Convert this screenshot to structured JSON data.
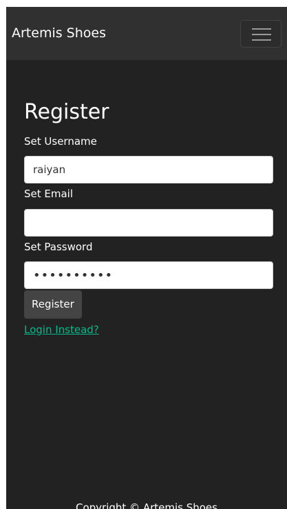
{
  "navbar": {
    "brand": "Artemis Shoes",
    "toggle_icon": "hamburger-menu-icon"
  },
  "form": {
    "title": "Register",
    "username": {
      "label": "Set Username",
      "value": "raiyan"
    },
    "email": {
      "label": "Set Email",
      "value": ""
    },
    "password": {
      "label": "Set Password",
      "value": "1234567890"
    },
    "submit_label": "Register",
    "login_link": "Login Instead?"
  },
  "footer": {
    "text": "Copyright © Artemis Shoes"
  },
  "colors": {
    "page_background": "#222222",
    "navbar_background": "#303030",
    "button_background": "#444444",
    "link": "#00bc8c",
    "text": "#ffffff"
  }
}
